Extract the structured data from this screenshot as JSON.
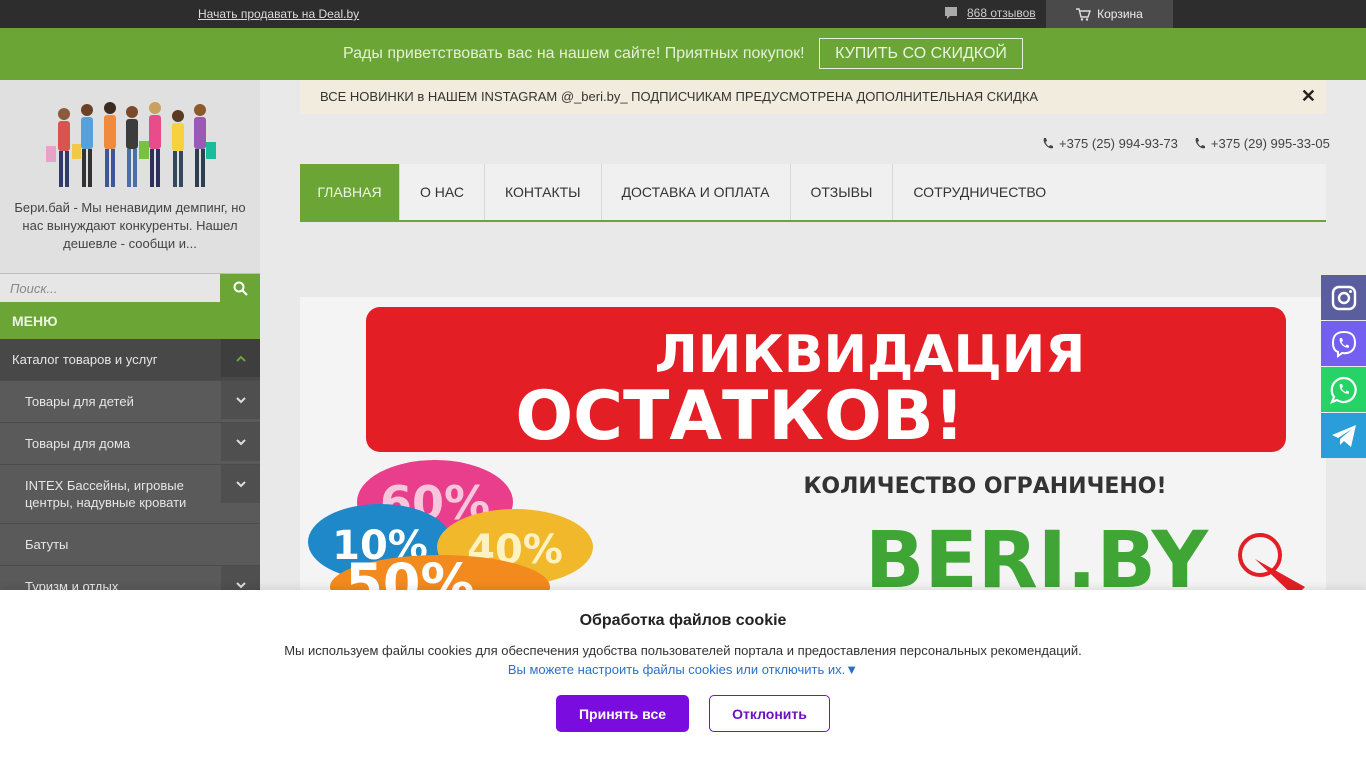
{
  "topbar": {
    "sell_link": "Начать продавать на Deal.by",
    "reviews": "868 отзывов",
    "cart": "Корзина"
  },
  "promo": {
    "message": "Рады приветствовать вас на нашем сайте! Приятных покупок!",
    "button": "КУПИТЬ СО СКИДКОЙ"
  },
  "sidebar": {
    "slogan": "Бери.бай - Мы ненавидим демпинг, но нас вынуждают конкуренты. Нашел дешевле - сообщи и...",
    "search_placeholder": "Поиск...",
    "menu_title": "МЕНЮ",
    "items": [
      {
        "label": "Каталог товаров и услуг",
        "toggle": "up"
      },
      {
        "label": "Товары для детей",
        "toggle": "down"
      },
      {
        "label": "Товары для дома",
        "toggle": "down"
      },
      {
        "label": "INTEX Бассейны, игровые центры, надувные кровати",
        "toggle": "down"
      },
      {
        "label": "Батуты",
        "toggle": "none"
      },
      {
        "label": "Туризм и отдых",
        "toggle": "down"
      }
    ]
  },
  "announcement": {
    "text": "ВСЕ НОВИНКИ в НАШЕМ INSTAGRAM @_beri.by_ ПОДПИСЧИКАМ ПРЕДУСМОТРЕНА ДОПОЛНИТЕЛЬНАЯ СКИДКА",
    "close": "✕"
  },
  "phones": [
    "+375 (25) 994-93-73",
    "+375 (29) 995-33-05"
  ],
  "nav": [
    "ГЛАВНАЯ",
    "О НАС",
    "КОНТАКТЫ",
    "ДОСТАВКА И ОПЛАТА",
    "ОТЗЫВЫ",
    "СОТРУДНИЧЕСТВО"
  ],
  "banner": {
    "line1": "ЛИКВИДАЦИЯ",
    "line2": "ОСТАТКОВ!",
    "line3": "КОЛИЧЕСТВО ОГРАНИЧЕНО!",
    "brand": "BERI.BY",
    "percents": [
      "60%",
      "10%",
      "40%",
      "50%"
    ]
  },
  "social": [
    {
      "icon": "instagram-icon",
      "color": "#5b5e9e"
    },
    {
      "icon": "viber-icon",
      "color": "#7360f2"
    },
    {
      "icon": "whatsapp-icon",
      "color": "#25d366"
    },
    {
      "icon": "telegram-icon",
      "color": "#2a9ed8"
    }
  ],
  "cookie": {
    "title": "Обработка файлов cookie",
    "text": "Мы используем файлы cookies для обеспечения удобства пользователей портала и предоставления персональных рекомендаций.",
    "settings_link": "Вы можете настроить файлы cookies или отключить их.▼",
    "accept": "Принять все",
    "decline": "Отклонить"
  },
  "colors": {
    "brand_green": "#6aa536",
    "accent_purple": "#7a0ce0"
  }
}
